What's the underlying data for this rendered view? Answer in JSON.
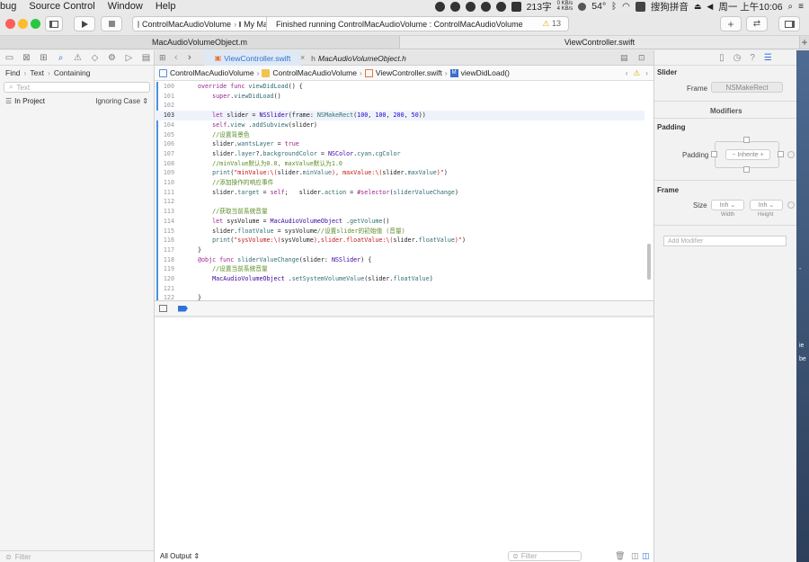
{
  "menubar": {
    "items": [
      "bug",
      "Source Control",
      "Window",
      "Help"
    ],
    "status": {
      "net_up": "0 KB/s",
      "net_down": "4 KB/s",
      "word_count": "213字",
      "temperature": "54°",
      "input_method": "搜狗拼音",
      "clock": "周一 上午10:06"
    }
  },
  "toolbar": {
    "scheme_name": "ControlMacAudioVolume",
    "destination": "My Mac",
    "activity_text": "Finished running ControlMacAudioVolume : ControlMacAudioVolume",
    "warning_count": "13"
  },
  "window_tabs": [
    "MacAudioVolumeObject.m",
    "ViewController.swift"
  ],
  "editor_tabs": [
    "ViewController.swift",
    "MacAudioVolumeObject.h"
  ],
  "jumpbar": [
    "ControlMacAudioVolume",
    "ControlMacAudioVolume",
    "ViewController.swift",
    "viewDidLoad()"
  ],
  "navigator": {
    "find_path": [
      "Find",
      "Text",
      "Containing"
    ],
    "search_placeholder": "Text",
    "scope": "In Project",
    "case_option": "Ignoring Case",
    "filter_placeholder": "Filter"
  },
  "code_lines": [
    {
      "n": "100",
      "html": "<span class=\"kw\">override func</span> <span class=\"fn\">viewDidLoad</span>() {"
    },
    {
      "n": "101",
      "html": "    <span class=\"kw\">super</span>.<span class=\"fn\">viewDidLoad</span>()"
    },
    {
      "n": "102",
      "html": ""
    },
    {
      "n": "103",
      "html": "    <span class=\"kw\">let</span> slider = <span class=\"ty\">NSSlider</span>(frame: <span class=\"fn\">NSMakeRect</span>(<span class=\"nm\">100</span>, <span class=\"nm\">100</span>, <span class=\"nm\">200</span>, <span class=\"nm\">50</span>))"
    },
    {
      "n": "104",
      "html": "    <span class=\"kw\">self</span>.<span class=\"fn\">view</span> .<span class=\"fn\">addSubview</span>(slider)"
    },
    {
      "n": "105",
      "html": "    <span class=\"cm\">//设置背景色</span>"
    },
    {
      "n": "106",
      "html": "    slider.<span class=\"fn\">wantsLayer</span> = <span class=\"kw\">true</span>"
    },
    {
      "n": "107",
      "html": "    slider.<span class=\"fn\">layer</span>?.<span class=\"fn\">backgroundColor</span> = <span class=\"ty\">NSColor</span>.<span class=\"fn\">cyan</span>.<span class=\"fn\">cgColor</span>"
    },
    {
      "n": "108",
      "html": "    <span class=\"cm\">//minValue默认为0.0, maxValue默认为1.0</span>"
    },
    {
      "n": "109",
      "html": "    <span class=\"fn\">print</span>(<span class=\"st\">\"minValue:\\(</span>slider.<span class=\"fn\">minValue</span><span class=\"st\">), maxValue:\\(</span>slider.<span class=\"fn\">maxValue</span><span class=\"st\">)\"</span>)"
    },
    {
      "n": "110",
      "html": "    <span class=\"cm\">//添加操作的响应事件</span>"
    },
    {
      "n": "111",
      "html": "    slider.<span class=\"fn\">target</span> = <span class=\"kw\">self</span>;   slider.<span class=\"fn\">action</span> = <span class=\"kw\">#selector</span>(<span class=\"fn\">sliderValueChange</span>)"
    },
    {
      "n": "112",
      "html": ""
    },
    {
      "n": "113",
      "html": "    <span class=\"cm\">//获取当前系统音量</span>"
    },
    {
      "n": "114",
      "html": "    <span class=\"kw\">let</span> sysVolume = <span class=\"ty\">MacAudioVolumeObject</span> .<span class=\"fn\">getVolume</span>()"
    },
    {
      "n": "115",
      "html": "    slider.<span class=\"fn\">floatValue</span> = sysVolume<span class=\"cm\">//设置slider的初始值 (音量)</span>"
    },
    {
      "n": "116",
      "html": "    <span class=\"fn\">print</span>(<span class=\"st\">\"sysVolume:\\(</span>sysVolume<span class=\"st\">),slider.floatValue:\\(</span>slider.<span class=\"fn\">floatValue</span><span class=\"st\">)\"</span>)"
    },
    {
      "n": "117",
      "html": "}"
    },
    {
      "n": "118",
      "html": "<span class=\"kw\">@objc func</span> <span class=\"fn\">sliderValueChange</span>(slider: <span class=\"ty\">NSSlider</span>) {"
    },
    {
      "n": "119",
      "html": "    <span class=\"cm\">//设置当前系统音量</span>"
    },
    {
      "n": "120",
      "html": "    <span class=\"ty\">MacAudioVolumeObject</span> .<span class=\"fn\">setSystemVolumeValue</span>(slider.<span class=\"fn\">floatValue</span>)"
    },
    {
      "n": "121",
      "html": ""
    },
    {
      "n": "122",
      "html": "}"
    }
  ],
  "console": {
    "output_selector": "All Output",
    "filter_placeholder": "Filter"
  },
  "inspector": {
    "title": "Slider",
    "frame_label": "Frame",
    "frame_value": "NSMakeRect",
    "modifiers_header": "Modifiers",
    "padding_section": "Padding",
    "padding_label": "Padding",
    "padding_value": "Inherite",
    "frame_section": "Frame",
    "size_label": "Size",
    "width_value": "Inh",
    "height_value": "Inh",
    "width_sub": "Width",
    "height_sub": "Height",
    "add_modifier_placeholder": "Add Modifier"
  },
  "desktop_strip": [
    "-",
    "ie",
    "be"
  ]
}
